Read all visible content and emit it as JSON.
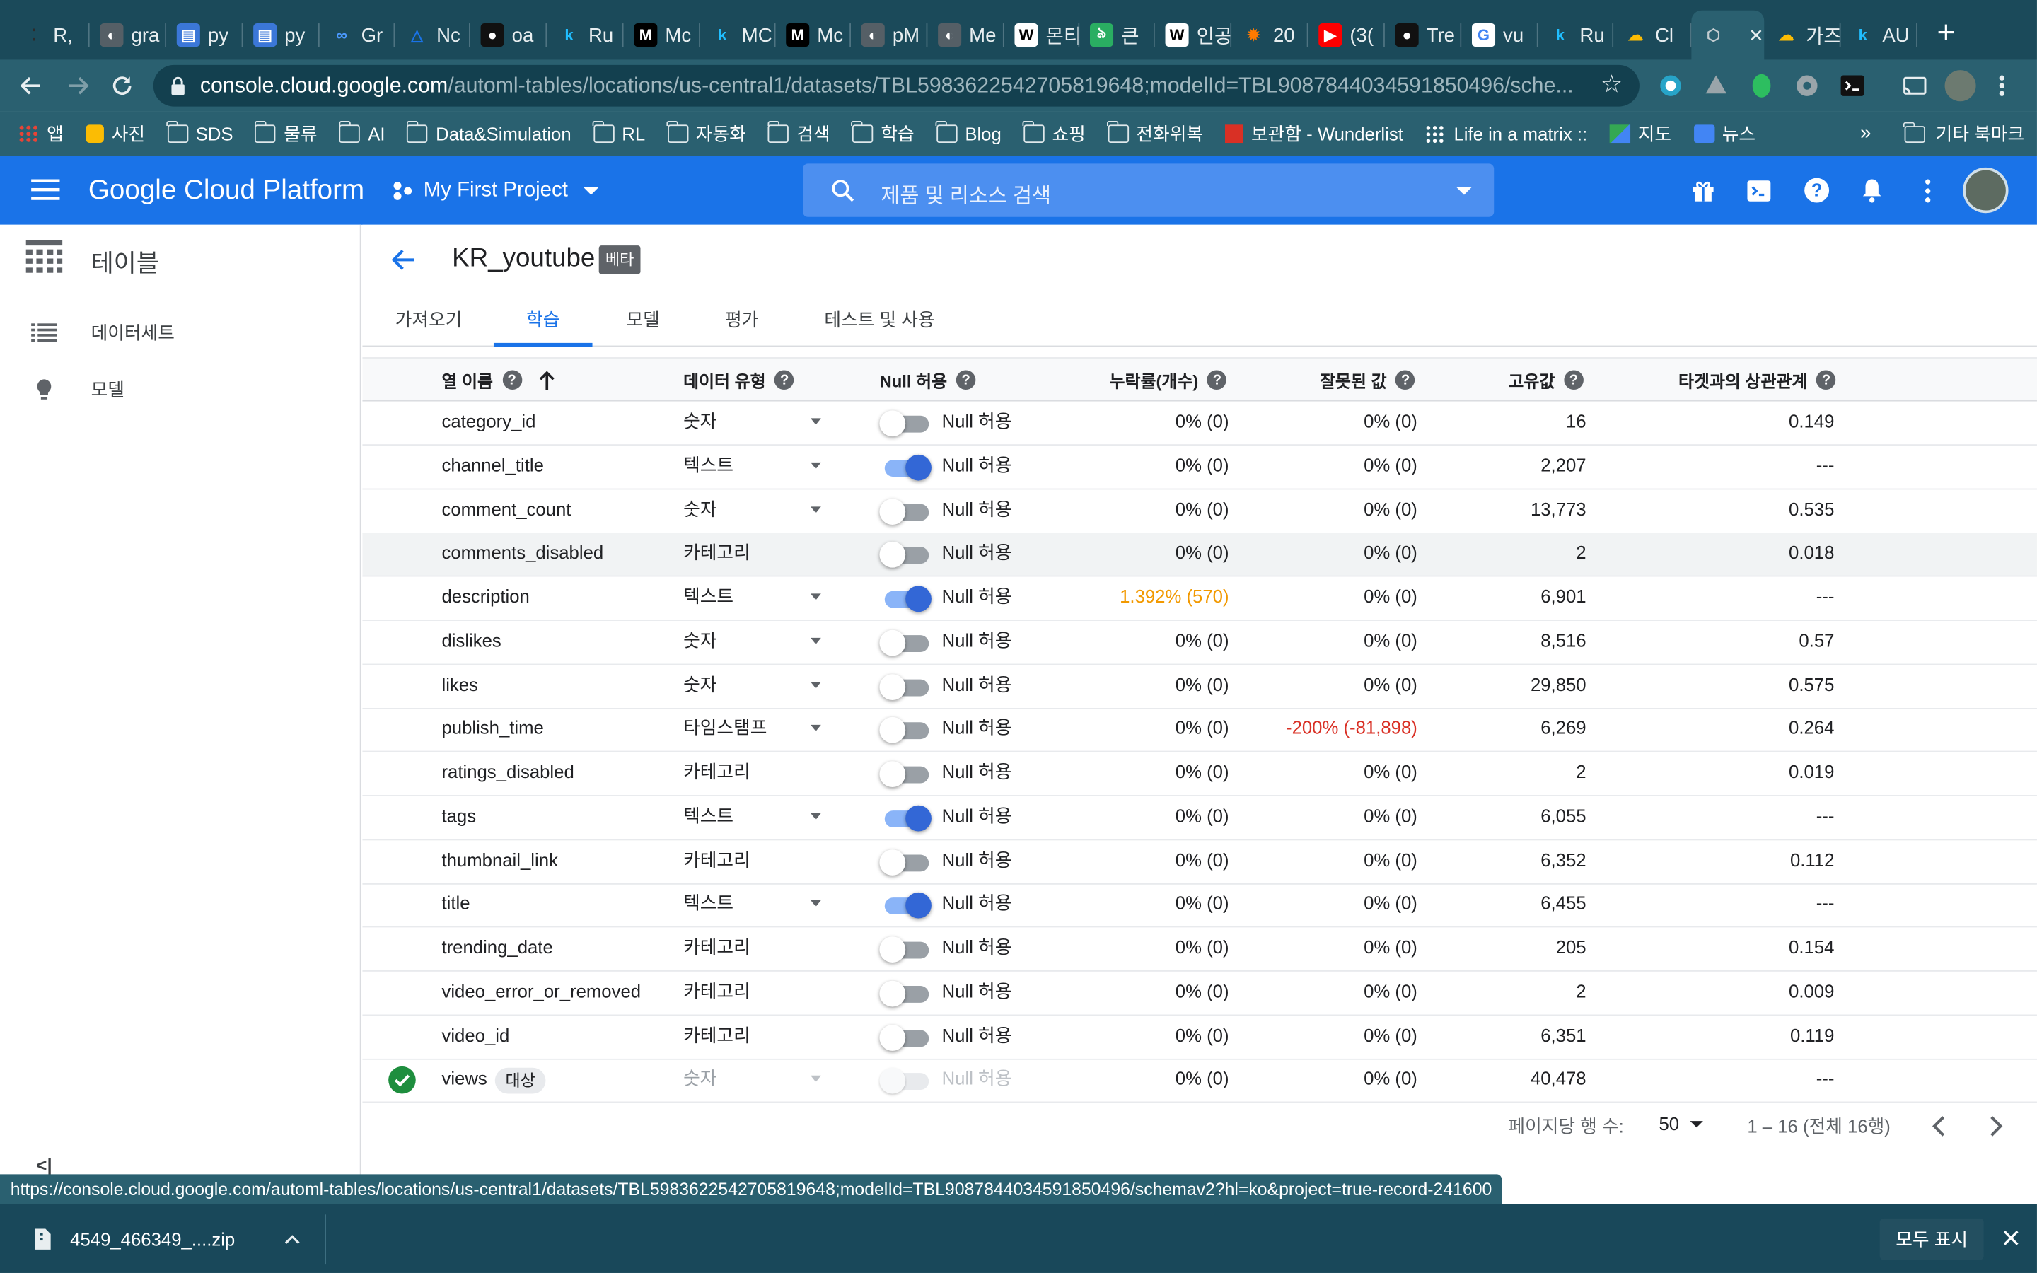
{
  "browser": {
    "tabs": [
      {
        "label": "R,",
        "fav": "⁚",
        "fc": "#2b2b2b",
        "fb": "transparent"
      },
      {
        "label": "gra",
        "fav": "◐",
        "fc": "#ffffff",
        "fb": "#555f66"
      },
      {
        "label": "py",
        "fav": "▤",
        "fc": "#ffffff",
        "fb": "#3b77d8"
      },
      {
        "label": "py",
        "fav": "▤",
        "fc": "#ffffff",
        "fb": "#3b77d8"
      },
      {
        "label": "Gr",
        "fav": "∞",
        "fc": "#4c9aff",
        "fb": "transparent"
      },
      {
        "label": "Nc",
        "fav": "△",
        "fc": "#1a73e8",
        "fb": "transparent"
      },
      {
        "label": "oa",
        "fav": "●",
        "fc": "#ffffff",
        "fb": "#111111"
      },
      {
        "label": "Ru",
        "fav": "k",
        "fc": "#20beff",
        "fb": "transparent"
      },
      {
        "label": "Mc",
        "fav": "M",
        "fc": "#ffffff",
        "fb": "#000000"
      },
      {
        "label": "MC",
        "fav": "k",
        "fc": "#20beff",
        "fb": "transparent"
      },
      {
        "label": "Mc",
        "fav": "M",
        "fc": "#ffffff",
        "fb": "#000000"
      },
      {
        "label": "pM",
        "fav": "◐",
        "fc": "#ffffff",
        "fb": "#555f66"
      },
      {
        "label": "Me",
        "fav": "◐",
        "fc": "#ffffff",
        "fb": "#555f66"
      },
      {
        "label": "몬티",
        "fav": "W",
        "fc": "#000000",
        "fb": "#ffffff"
      },
      {
        "label": "큰",
        "fav": "ঌ",
        "fc": "#ffffff",
        "fb": "#2aae62"
      },
      {
        "label": "인공",
        "fav": "W",
        "fc": "#000000",
        "fb": "#ffffff"
      },
      {
        "label": "20",
        "fav": "✹",
        "fc": "#ff7a00",
        "fb": "transparent"
      },
      {
        "label": "(3(",
        "fav": "▶",
        "fc": "#ffffff",
        "fb": "#ff0000"
      },
      {
        "label": "Tre",
        "fav": "●",
        "fc": "#ffffff",
        "fb": "#111111"
      },
      {
        "label": "vu",
        "fav": "G",
        "fc": "#4285f4",
        "fb": "#ffffff"
      },
      {
        "label": "Ru",
        "fav": "k",
        "fc": "#20beff",
        "fb": "transparent"
      },
      {
        "label": "Cl",
        "fav": "☁",
        "fc": "#fbbc04",
        "fb": "transparent"
      },
      {
        "label": "",
        "fav": "⬡",
        "fc": "#c3ccd0",
        "fb": "transparent"
      },
      {
        "label": "가즈",
        "fav": "☁",
        "fc": "#fbbc04",
        "fb": "transparent"
      },
      {
        "label": "AU",
        "fav": "k",
        "fc": "#20beff",
        "fb": "transparent"
      }
    ],
    "new_tab": "+",
    "url_host": "console.cloud.google.com",
    "url_path": "/automl-tables/locations/us-central1/datasets/TBL5983622542705819648;modelId=TBL9087844034591850496/sche..."
  },
  "bookmarks": {
    "items": [
      {
        "label": "앱",
        "kind": "apps"
      },
      {
        "label": "사진",
        "kind": "d"
      },
      {
        "label": "SDS",
        "kind": "folder"
      },
      {
        "label": "물류",
        "kind": "folder"
      },
      {
        "label": "AI",
        "kind": "folder"
      },
      {
        "label": "Data&Simulation",
        "kind": "folder"
      },
      {
        "label": "RL",
        "kind": "folder"
      },
      {
        "label": "자동화",
        "kind": "folder"
      },
      {
        "label": "검색",
        "kind": "folder"
      },
      {
        "label": "학습",
        "kind": "folder"
      },
      {
        "label": "Blog",
        "kind": "folder"
      },
      {
        "label": "쇼핑",
        "kind": "folder"
      },
      {
        "label": "전화위복",
        "kind": "folder"
      },
      {
        "label": "보관함 - Wunderlist",
        "kind": "star"
      },
      {
        "label": "Life in a matrix ::",
        "kind": "dots"
      },
      {
        "label": "지도",
        "kind": "map"
      },
      {
        "label": "뉴스",
        "kind": "news"
      }
    ],
    "more": "»",
    "other_label": "기타 북마크"
  },
  "gcp": {
    "logo": "Google Cloud Platform",
    "project": "My First Project",
    "search_placeholder": "제품 및 리소스 검색"
  },
  "sidebar": {
    "title": "테이블",
    "items": [
      {
        "label": "데이터세트"
      },
      {
        "label": "모델"
      }
    ],
    "collapse": "<|"
  },
  "page": {
    "dataset_name": "KR_youtube",
    "beta": "베타",
    "tabs": [
      {
        "label": "가져오기"
      },
      {
        "label": "학습"
      },
      {
        "label": "모델"
      },
      {
        "label": "평가"
      },
      {
        "label": "테스트 및 사용"
      }
    ],
    "active_tab": "학습"
  },
  "table": {
    "headers": {
      "name": "열 이름",
      "type": "데이터 유형",
      "nullable": "Null 허용",
      "missing": "누락률(개수)",
      "invalid": "잘못된 값",
      "distinct": "고유값",
      "correlation": "타겟과의 상관관계"
    },
    "null_label": "Null 허용",
    "rows": [
      {
        "name": "category_id",
        "type": "숫자",
        "dropdown": true,
        "nullable": false,
        "missing": "0% (0)",
        "invalid": "0% (0)",
        "distinct": "16",
        "correlation": "0.149"
      },
      {
        "name": "channel_title",
        "type": "텍스트",
        "dropdown": true,
        "nullable": true,
        "missing": "0% (0)",
        "invalid": "0% (0)",
        "distinct": "2,207",
        "correlation": "---"
      },
      {
        "name": "comment_count",
        "type": "숫자",
        "dropdown": true,
        "nullable": false,
        "missing": "0% (0)",
        "invalid": "0% (0)",
        "distinct": "13,773",
        "correlation": "0.535"
      },
      {
        "name": "comments_disabled",
        "type": "카테고리",
        "dropdown": false,
        "nullable": false,
        "missing": "0% (0)",
        "invalid": "0% (0)",
        "distinct": "2",
        "correlation": "0.018",
        "highlight": true
      },
      {
        "name": "description",
        "type": "텍스트",
        "dropdown": true,
        "nullable": true,
        "missing": "1.392% (570)",
        "missing_color": "#f29900",
        "invalid": "0% (0)",
        "distinct": "6,901",
        "correlation": "---"
      },
      {
        "name": "dislikes",
        "type": "숫자",
        "dropdown": true,
        "nullable": false,
        "missing": "0% (0)",
        "invalid": "0% (0)",
        "distinct": "8,516",
        "correlation": "0.57"
      },
      {
        "name": "likes",
        "type": "숫자",
        "dropdown": true,
        "nullable": false,
        "missing": "0% (0)",
        "invalid": "0% (0)",
        "distinct": "29,850",
        "correlation": "0.575"
      },
      {
        "name": "publish_time",
        "type": "타임스탬프",
        "dropdown": true,
        "nullable": false,
        "missing": "0% (0)",
        "invalid": "-200% (-81,898)",
        "invalid_color": "#d93025",
        "distinct": "6,269",
        "correlation": "0.264"
      },
      {
        "name": "ratings_disabled",
        "type": "카테고리",
        "dropdown": false,
        "nullable": false,
        "missing": "0% (0)",
        "invalid": "0% (0)",
        "distinct": "2",
        "correlation": "0.019"
      },
      {
        "name": "tags",
        "type": "텍스트",
        "dropdown": true,
        "nullable": true,
        "missing": "0% (0)",
        "invalid": "0% (0)",
        "distinct": "6,055",
        "correlation": "---"
      },
      {
        "name": "thumbnail_link",
        "type": "카테고리",
        "dropdown": false,
        "nullable": false,
        "missing": "0% (0)",
        "invalid": "0% (0)",
        "distinct": "6,352",
        "correlation": "0.112"
      },
      {
        "name": "title",
        "type": "텍스트",
        "dropdown": true,
        "nullable": true,
        "missing": "0% (0)",
        "invalid": "0% (0)",
        "distinct": "6,455",
        "correlation": "---"
      },
      {
        "name": "trending_date",
        "type": "카테고리",
        "dropdown": false,
        "nullable": false,
        "missing": "0% (0)",
        "invalid": "0% (0)",
        "distinct": "205",
        "correlation": "0.154"
      },
      {
        "name": "video_error_or_removed",
        "type": "카테고리",
        "dropdown": false,
        "nullable": false,
        "missing": "0% (0)",
        "invalid": "0% (0)",
        "distinct": "2",
        "correlation": "0.009"
      },
      {
        "name": "video_id",
        "type": "카테고리",
        "dropdown": false,
        "nullable": false,
        "missing": "0% (0)",
        "invalid": "0% (0)",
        "distinct": "6,351",
        "correlation": "0.119"
      },
      {
        "name": "views",
        "type": "숫자",
        "dropdown": true,
        "nullable": false,
        "disabled": true,
        "target": true,
        "target_badge": "대상",
        "missing": "0% (0)",
        "invalid": "0% (0)",
        "distinct": "40,478",
        "correlation": "---"
      }
    ],
    "footer": {
      "rows_per_page_label": "페이지당 행 수:",
      "rows_per_page": "50",
      "range": "1 – 16 (전체 16행)"
    }
  },
  "status_url": "https://console.cloud.google.com/automl-tables/locations/us-central1/datasets/TBL5983622542705819648;modelId=TBL9087844034591850496/schemav2?hl=ko&project=true-record-241600",
  "download": {
    "file": "4549_466349_....zip",
    "show_all": "모두 표시"
  },
  "colors": {
    "gcp_blue": "#1a73e8",
    "chrome_frame": "#1b4a5a",
    "chrome_toolbar": "#2a6070",
    "warning": "#f29900",
    "error": "#d93025",
    "success": "#1e8e3e"
  }
}
